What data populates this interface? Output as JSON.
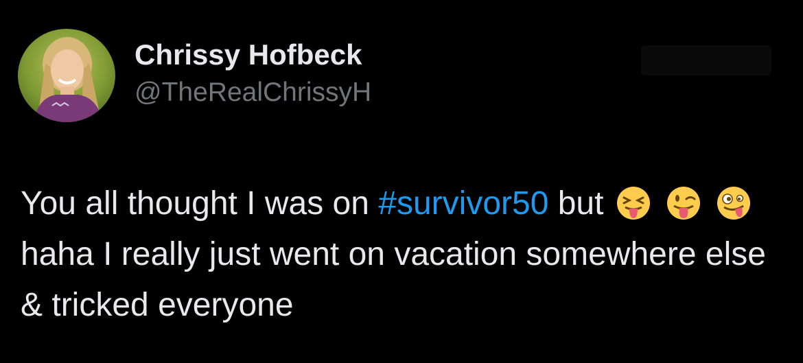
{
  "tweet": {
    "author": {
      "display_name": "Chrissy Hofbeck",
      "handle": "@TheRealChrissyH"
    },
    "text": {
      "part1": "You all thought I was on ",
      "hashtag": "#survivor50",
      "part2": " but ",
      "part3": " haha I really just went on vacation somewhere else & tricked everyone"
    },
    "emojis": {
      "emoji1": "squinting-face-with-tongue-icon",
      "emoji2": "winking-face-with-tongue-icon",
      "emoji3": "zany-face-icon"
    },
    "colors": {
      "background": "#000000",
      "text": "#e7e9ea",
      "secondary": "#71767b",
      "link": "#1d9bf0"
    }
  }
}
